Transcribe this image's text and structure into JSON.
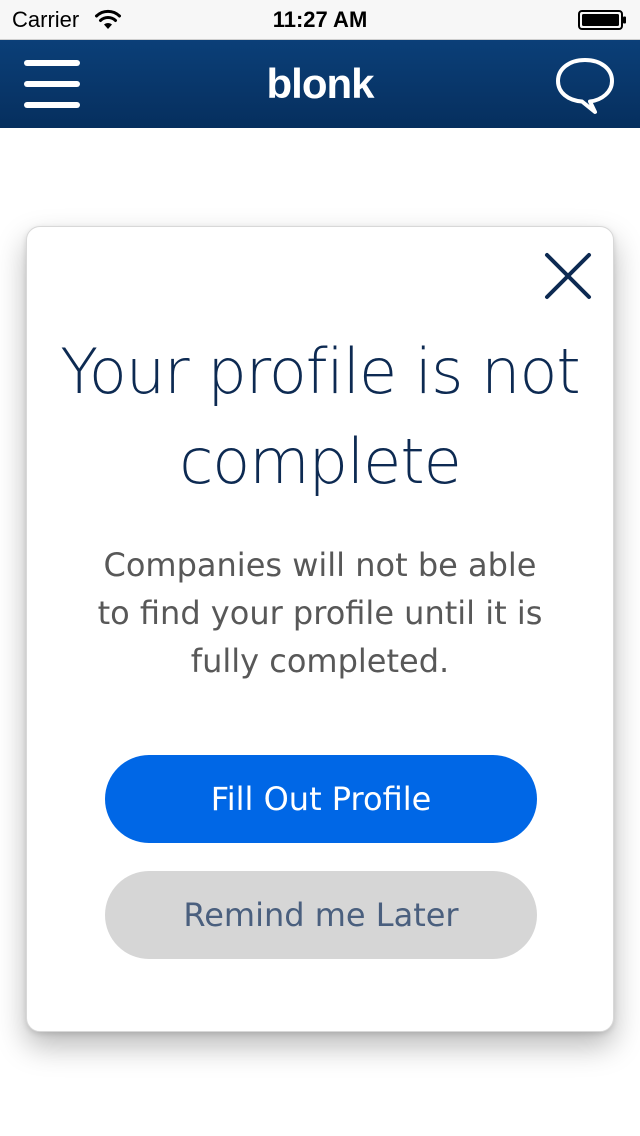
{
  "status_bar": {
    "carrier": "Carrier",
    "time": "11:27 AM",
    "wifi_icon": "wifi-icon",
    "battery_icon": "battery-full-icon"
  },
  "nav_bar": {
    "menu_icon": "hamburger-menu-icon",
    "brand": "blonk",
    "chat_icon": "chat-bubble-icon",
    "background_color": "#0b3f78"
  },
  "modal": {
    "close_icon": "close-icon",
    "title": "Your profile is not complete",
    "message": "Companies will not be able to find your profile until it is fully completed.",
    "primary_button": "Fill Out Profile",
    "secondary_button": "Remind me Later",
    "primary_color": "#0067e6",
    "secondary_color": "#d6d6d6",
    "title_color": "#0d2a52"
  }
}
